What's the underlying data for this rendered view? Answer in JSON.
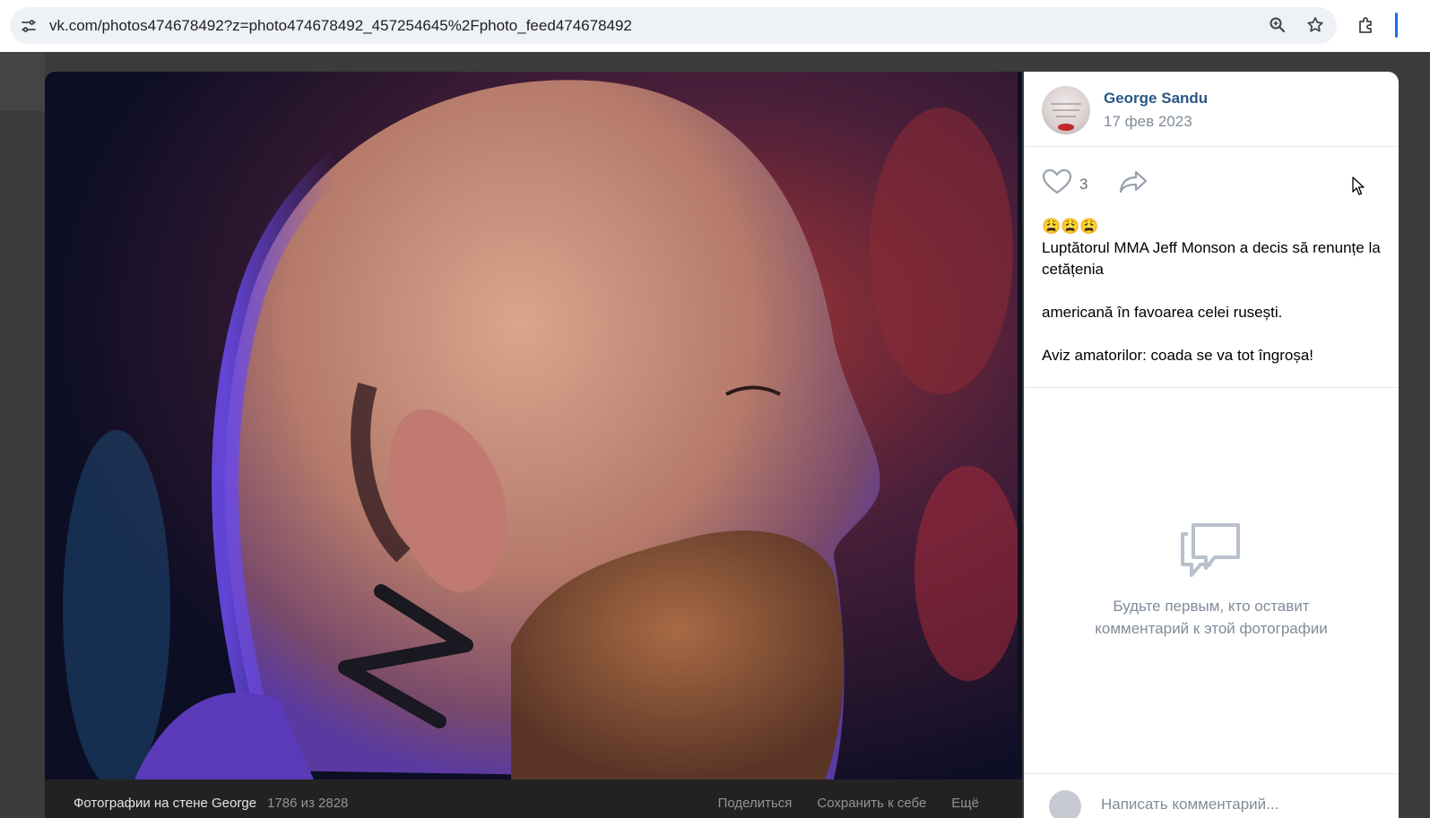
{
  "browser": {
    "url": "vk.com/photos474678492?z=photo474678492_457254645%2Fphoto_feed474678492",
    "icons": [
      "site-info-icon",
      "zoom-icon",
      "bookmark-star-icon",
      "extensions-icon"
    ]
  },
  "post": {
    "author_name": "George Sandu",
    "date": "17 фев 2023",
    "likes": "3",
    "emojis": "😩😩😩",
    "text_line1": "Luptătorul MMA Jeff Monson a decis să renunțe la cetățenia",
    "text_line2": "americană în favoarea celei rusești.",
    "text_line3": "Aviz amatorilor: coada se va tot îngroșa!"
  },
  "comments": {
    "empty_message": "Будьте первым, кто оставит комментарий к этой фотографии",
    "input_placeholder": "Написать комментарий..."
  },
  "photo_footer": {
    "album": "Фотографии на стене George",
    "counter": "1786 из 2828",
    "actions": [
      "Поделиться",
      "Сохранить к себе",
      "Ещё"
    ]
  },
  "colors": {
    "link": "#2a5885",
    "muted": "#818c99",
    "page_bg": "#3b3b3b"
  }
}
